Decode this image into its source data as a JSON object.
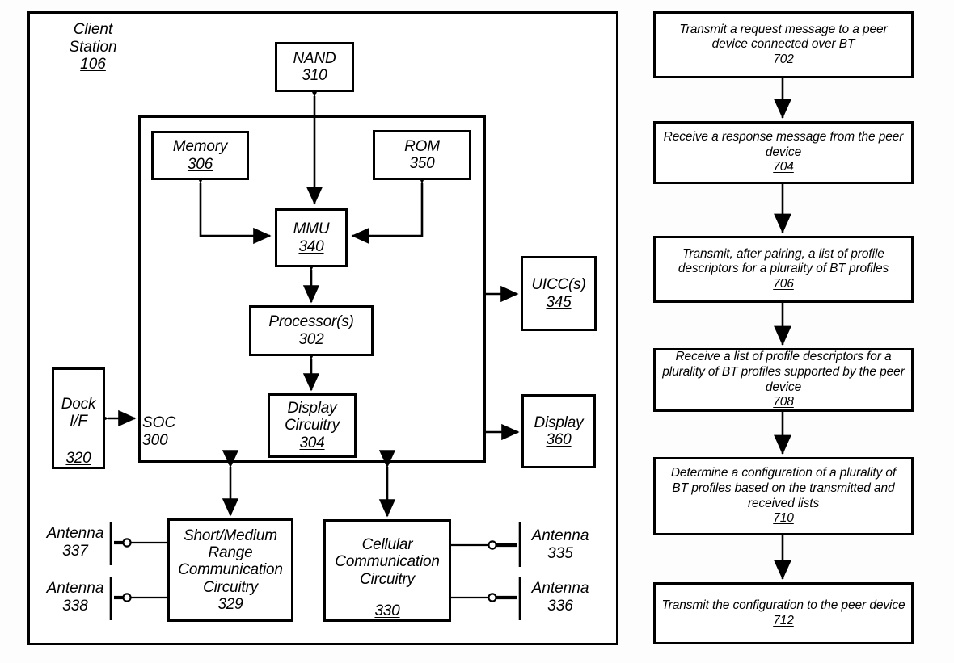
{
  "figure_left": {
    "title": {
      "line1": "Client",
      "line2": "Station",
      "num": "106"
    },
    "soc": {
      "label": "SOC",
      "num": "300"
    },
    "blocks": {
      "nand": {
        "label": "NAND",
        "num": "310"
      },
      "memory": {
        "label": "Memory",
        "num": "306"
      },
      "rom": {
        "label": "ROM",
        "num": "350"
      },
      "mmu": {
        "label": "MMU",
        "num": "340"
      },
      "processor": {
        "label": "Processor(s)",
        "num": "302"
      },
      "display_circuitry": {
        "line1": "Display",
        "line2": "Circuitry",
        "num": "304"
      },
      "uicc": {
        "label": "UICC(s)",
        "num": "345"
      },
      "display": {
        "label": "Display",
        "num": "360"
      },
      "dock": {
        "line1": "Dock",
        "line2": "I/F",
        "num": "320"
      },
      "short_medium": {
        "line1": "Short/Medium",
        "line2": "Range",
        "line3": "Communication",
        "line4": "Circuitry",
        "num": "329"
      },
      "cellular": {
        "line1": "Cellular",
        "line2": "Communication",
        "line3": "Circuitry",
        "num": "330"
      }
    },
    "antennas": [
      {
        "label": "Antenna",
        "num": "337"
      },
      {
        "label": "Antenna",
        "num": "338"
      },
      {
        "label": "Antenna",
        "num": "335"
      },
      {
        "label": "Antenna",
        "num": "336"
      }
    ]
  },
  "figure_right": {
    "steps": [
      {
        "text": "Transmit a request message to a peer device connected over BT",
        "num": "702"
      },
      {
        "text": "Receive a response message from the peer device",
        "num": "704"
      },
      {
        "text": "Transmit, after pairing, a list of profile descriptors for a plurality of BT profiles",
        "num": "706"
      },
      {
        "text": "Receive a list of profile descriptors for a plurality of BT profiles supported by the peer device",
        "num": "708"
      },
      {
        "text": "Determine a configuration of a plurality of BT profiles based on the transmitted and received lists",
        "num": "710"
      },
      {
        "text": "Transmit the configuration to the peer device",
        "num": "712"
      }
    ]
  },
  "colors": {
    "ink": "#000000",
    "paper": "#ffffff"
  }
}
